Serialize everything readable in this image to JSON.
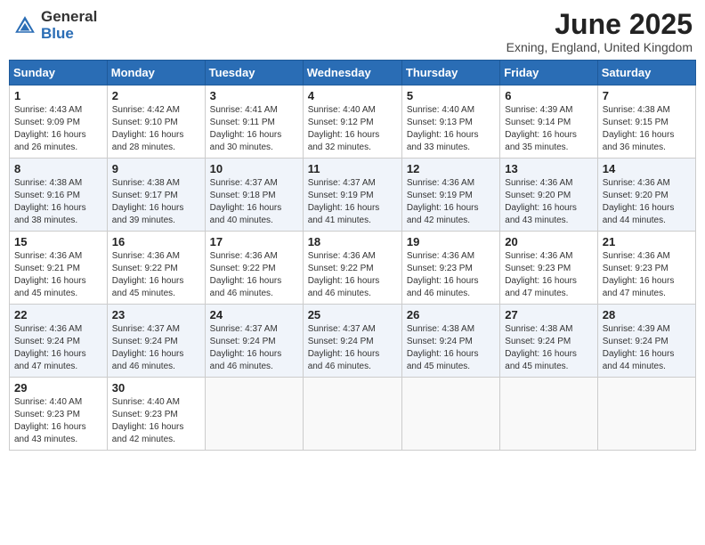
{
  "header": {
    "logo_general": "General",
    "logo_blue": "Blue",
    "month_title": "June 2025",
    "subtitle": "Exning, England, United Kingdom"
  },
  "days_of_week": [
    "Sunday",
    "Monday",
    "Tuesday",
    "Wednesday",
    "Thursday",
    "Friday",
    "Saturday"
  ],
  "weeks": [
    [
      {
        "day": "1",
        "info": "Sunrise: 4:43 AM\nSunset: 9:09 PM\nDaylight: 16 hours\nand 26 minutes."
      },
      {
        "day": "2",
        "info": "Sunrise: 4:42 AM\nSunset: 9:10 PM\nDaylight: 16 hours\nand 28 minutes."
      },
      {
        "day": "3",
        "info": "Sunrise: 4:41 AM\nSunset: 9:11 PM\nDaylight: 16 hours\nand 30 minutes."
      },
      {
        "day": "4",
        "info": "Sunrise: 4:40 AM\nSunset: 9:12 PM\nDaylight: 16 hours\nand 32 minutes."
      },
      {
        "day": "5",
        "info": "Sunrise: 4:40 AM\nSunset: 9:13 PM\nDaylight: 16 hours\nand 33 minutes."
      },
      {
        "day": "6",
        "info": "Sunrise: 4:39 AM\nSunset: 9:14 PM\nDaylight: 16 hours\nand 35 minutes."
      },
      {
        "day": "7",
        "info": "Sunrise: 4:38 AM\nSunset: 9:15 PM\nDaylight: 16 hours\nand 36 minutes."
      }
    ],
    [
      {
        "day": "8",
        "info": "Sunrise: 4:38 AM\nSunset: 9:16 PM\nDaylight: 16 hours\nand 38 minutes."
      },
      {
        "day": "9",
        "info": "Sunrise: 4:38 AM\nSunset: 9:17 PM\nDaylight: 16 hours\nand 39 minutes."
      },
      {
        "day": "10",
        "info": "Sunrise: 4:37 AM\nSunset: 9:18 PM\nDaylight: 16 hours\nand 40 minutes."
      },
      {
        "day": "11",
        "info": "Sunrise: 4:37 AM\nSunset: 9:19 PM\nDaylight: 16 hours\nand 41 minutes."
      },
      {
        "day": "12",
        "info": "Sunrise: 4:36 AM\nSunset: 9:19 PM\nDaylight: 16 hours\nand 42 minutes."
      },
      {
        "day": "13",
        "info": "Sunrise: 4:36 AM\nSunset: 9:20 PM\nDaylight: 16 hours\nand 43 minutes."
      },
      {
        "day": "14",
        "info": "Sunrise: 4:36 AM\nSunset: 9:20 PM\nDaylight: 16 hours\nand 44 minutes."
      }
    ],
    [
      {
        "day": "15",
        "info": "Sunrise: 4:36 AM\nSunset: 9:21 PM\nDaylight: 16 hours\nand 45 minutes."
      },
      {
        "day": "16",
        "info": "Sunrise: 4:36 AM\nSunset: 9:22 PM\nDaylight: 16 hours\nand 45 minutes."
      },
      {
        "day": "17",
        "info": "Sunrise: 4:36 AM\nSunset: 9:22 PM\nDaylight: 16 hours\nand 46 minutes."
      },
      {
        "day": "18",
        "info": "Sunrise: 4:36 AM\nSunset: 9:22 PM\nDaylight: 16 hours\nand 46 minutes."
      },
      {
        "day": "19",
        "info": "Sunrise: 4:36 AM\nSunset: 9:23 PM\nDaylight: 16 hours\nand 46 minutes."
      },
      {
        "day": "20",
        "info": "Sunrise: 4:36 AM\nSunset: 9:23 PM\nDaylight: 16 hours\nand 47 minutes."
      },
      {
        "day": "21",
        "info": "Sunrise: 4:36 AM\nSunset: 9:23 PM\nDaylight: 16 hours\nand 47 minutes."
      }
    ],
    [
      {
        "day": "22",
        "info": "Sunrise: 4:36 AM\nSunset: 9:24 PM\nDaylight: 16 hours\nand 47 minutes."
      },
      {
        "day": "23",
        "info": "Sunrise: 4:37 AM\nSunset: 9:24 PM\nDaylight: 16 hours\nand 46 minutes."
      },
      {
        "day": "24",
        "info": "Sunrise: 4:37 AM\nSunset: 9:24 PM\nDaylight: 16 hours\nand 46 minutes."
      },
      {
        "day": "25",
        "info": "Sunrise: 4:37 AM\nSunset: 9:24 PM\nDaylight: 16 hours\nand 46 minutes."
      },
      {
        "day": "26",
        "info": "Sunrise: 4:38 AM\nSunset: 9:24 PM\nDaylight: 16 hours\nand 45 minutes."
      },
      {
        "day": "27",
        "info": "Sunrise: 4:38 AM\nSunset: 9:24 PM\nDaylight: 16 hours\nand 45 minutes."
      },
      {
        "day": "28",
        "info": "Sunrise: 4:39 AM\nSunset: 9:24 PM\nDaylight: 16 hours\nand 44 minutes."
      }
    ],
    [
      {
        "day": "29",
        "info": "Sunrise: 4:40 AM\nSunset: 9:23 PM\nDaylight: 16 hours\nand 43 minutes."
      },
      {
        "day": "30",
        "info": "Sunrise: 4:40 AM\nSunset: 9:23 PM\nDaylight: 16 hours\nand 42 minutes."
      },
      null,
      null,
      null,
      null,
      null
    ]
  ]
}
